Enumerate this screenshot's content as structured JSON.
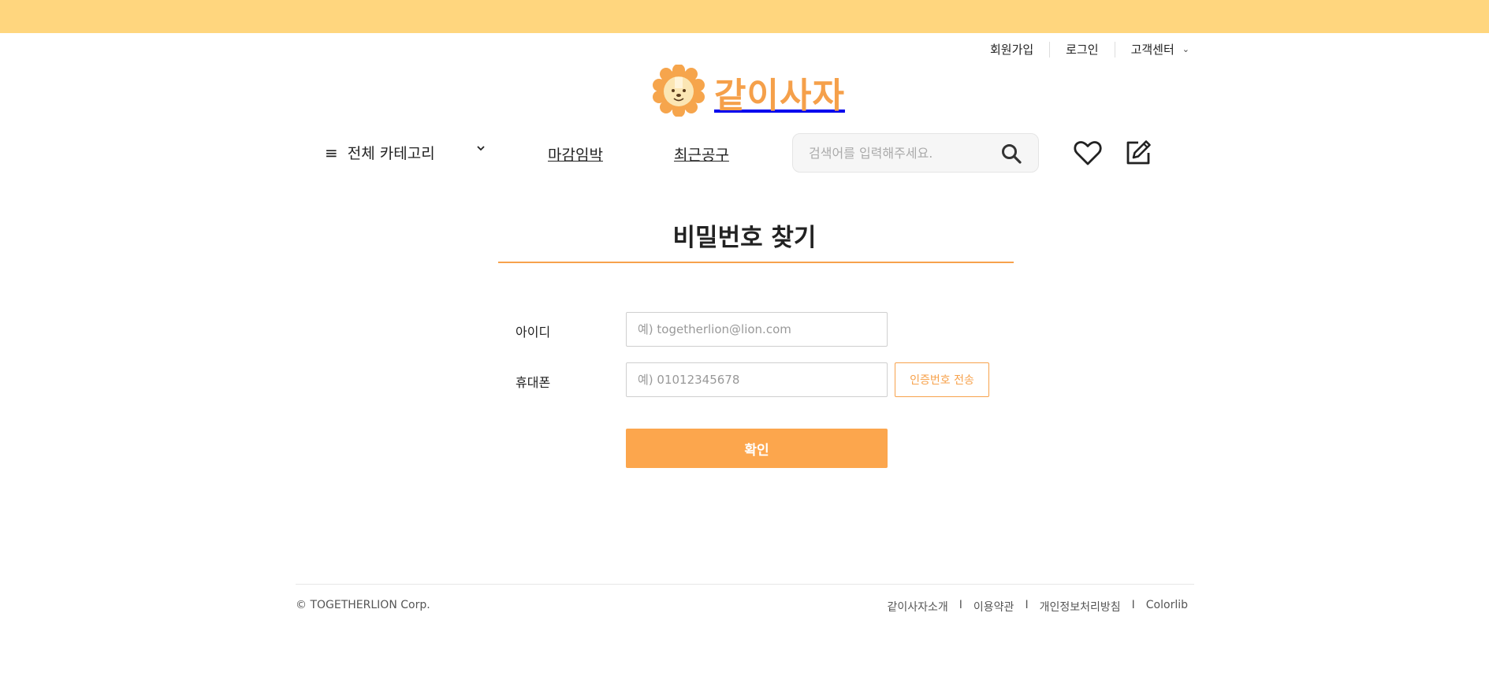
{
  "util_nav": {
    "signup": "회원가입",
    "login": "로그인",
    "support": "고객센터",
    "support_chevron": "⌄"
  },
  "logo": {
    "text": "같이사자",
    "icon": "lion-icon"
  },
  "nav": {
    "category": "전체 카테고리",
    "category_icon": "≡",
    "closing_soon": "마감임박",
    "recent_group": "최근공구",
    "search_placeholder": "검색어를 입력해주세요.",
    "search_value": "",
    "wishlist_icon": "heart-icon",
    "write_icon": "edit-icon"
  },
  "page": {
    "title": "비밀번호 찾기",
    "accent_color": "#f7a24c",
    "top_bar_color": "#ffd67e"
  },
  "form": {
    "id_label": "아이디",
    "id_placeholder": "예) togetherlion@lion.com",
    "id_value": "",
    "phone_label": "휴대폰",
    "phone_placeholder": "예) 01012345678",
    "phone_value": "",
    "send_code_label": "인증번호 전송",
    "confirm_label": "확인"
  },
  "footer": {
    "copyright": "© TOGETHERLION Corp.",
    "links": [
      "같이사자소개",
      "이용약관",
      "개인정보처리방침",
      "Colorlib"
    ],
    "separator": "I"
  }
}
